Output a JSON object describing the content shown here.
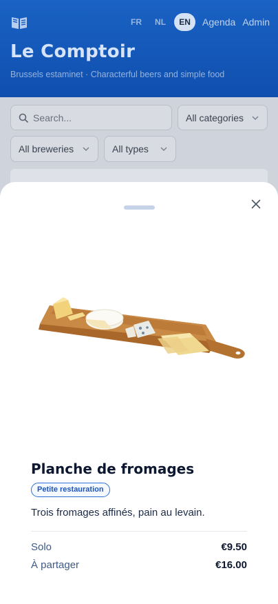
{
  "header": {
    "languages": [
      "FR",
      "NL",
      "EN"
    ],
    "active_language": "EN",
    "nav": {
      "agenda": "Agenda",
      "admin": "Admin"
    },
    "title": "Le Comptoir",
    "subtitle": "Brussels estaminet · Characterful beers and simple food",
    "logo_icon": "menu-book-icon"
  },
  "filters": {
    "search_placeholder": "Search...",
    "category": "All categories",
    "brewery": "All breweries",
    "type": "All types"
  },
  "sheet": {
    "item_name": "Planche de fromages",
    "category_badge": "Petite restauration",
    "description": "Trois fromages affinés, pain au levain.",
    "prices": [
      {
        "label": "Solo",
        "amount": "€9.50"
      },
      {
        "label": "À partager",
        "amount": "€16.00"
      }
    ],
    "image_icon": "cheese-board-image"
  },
  "colors": {
    "header_bg": "#1559bb",
    "accent": "#2f6fd6",
    "overlay": "#cfd3db"
  }
}
